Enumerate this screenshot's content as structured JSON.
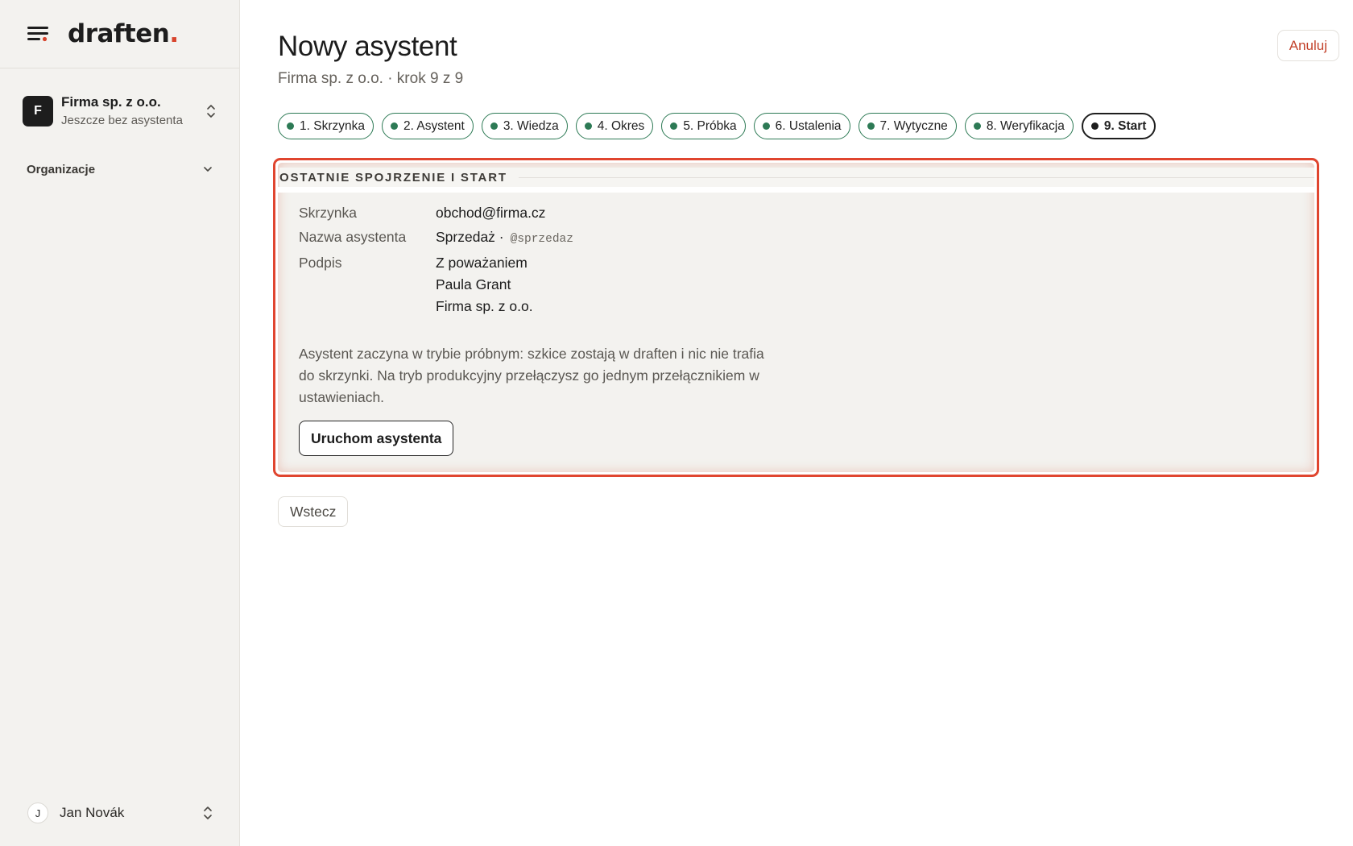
{
  "app": {
    "logo_text": "draften",
    "logo_dot": ".",
    "brand_color": "#d8452e"
  },
  "sidebar": {
    "org": {
      "avatar_letter": "F",
      "name": "Firma sp. z o.o.",
      "subtitle": "Jeszcze bez asystenta"
    },
    "section_label": "Organizacje",
    "user": {
      "avatar_letter": "J",
      "name": "Jan Novák"
    }
  },
  "header": {
    "title": "Nowy asystent",
    "subtitle": "Firma sp. z o.o. · krok 9 z 9",
    "cancel_label": "Anuluj"
  },
  "steps": [
    {
      "label": "1. Skrzynka",
      "status": "done"
    },
    {
      "label": "2. Asystent",
      "status": "done"
    },
    {
      "label": "3. Wiedza",
      "status": "done"
    },
    {
      "label": "4. Okres",
      "status": "done"
    },
    {
      "label": "5. Próbka",
      "status": "done"
    },
    {
      "label": "6. Ustalenia",
      "status": "done"
    },
    {
      "label": "7. Wytyczne",
      "status": "done"
    },
    {
      "label": "8. Weryfikacja",
      "status": "done"
    },
    {
      "label": "9. Start",
      "status": "active"
    }
  ],
  "review": {
    "title": "OSTATNIE SPOJRZENIE I START",
    "mailbox_label": "Skrzynka",
    "mailbox_value": "obchod@firma.cz",
    "assistant_label": "Nazwa asystenta",
    "assistant_value": "Sprzedaż ·",
    "assistant_handle": "@sprzedaz",
    "signature_label": "Podpis",
    "signature_lines": [
      "Z poważaniem",
      "Paula Grant",
      "Firma sp. z o.o."
    ],
    "notice": "Asystent zaczyna w trybie próbnym: szkice zostają w draften i nic nie trafia do skrzynki. Na tryb produkcyjny przełączysz go jednym przełącznikiem w ustawieniach.",
    "launch_label": "Uruchom asystenta"
  },
  "footer": {
    "back_label": "Wstecz"
  },
  "colors": {
    "done_step": "#2d7a55",
    "active_step": "#1e1e1e",
    "highlight": "#e0452f",
    "cancel_text": "#c3432c"
  }
}
